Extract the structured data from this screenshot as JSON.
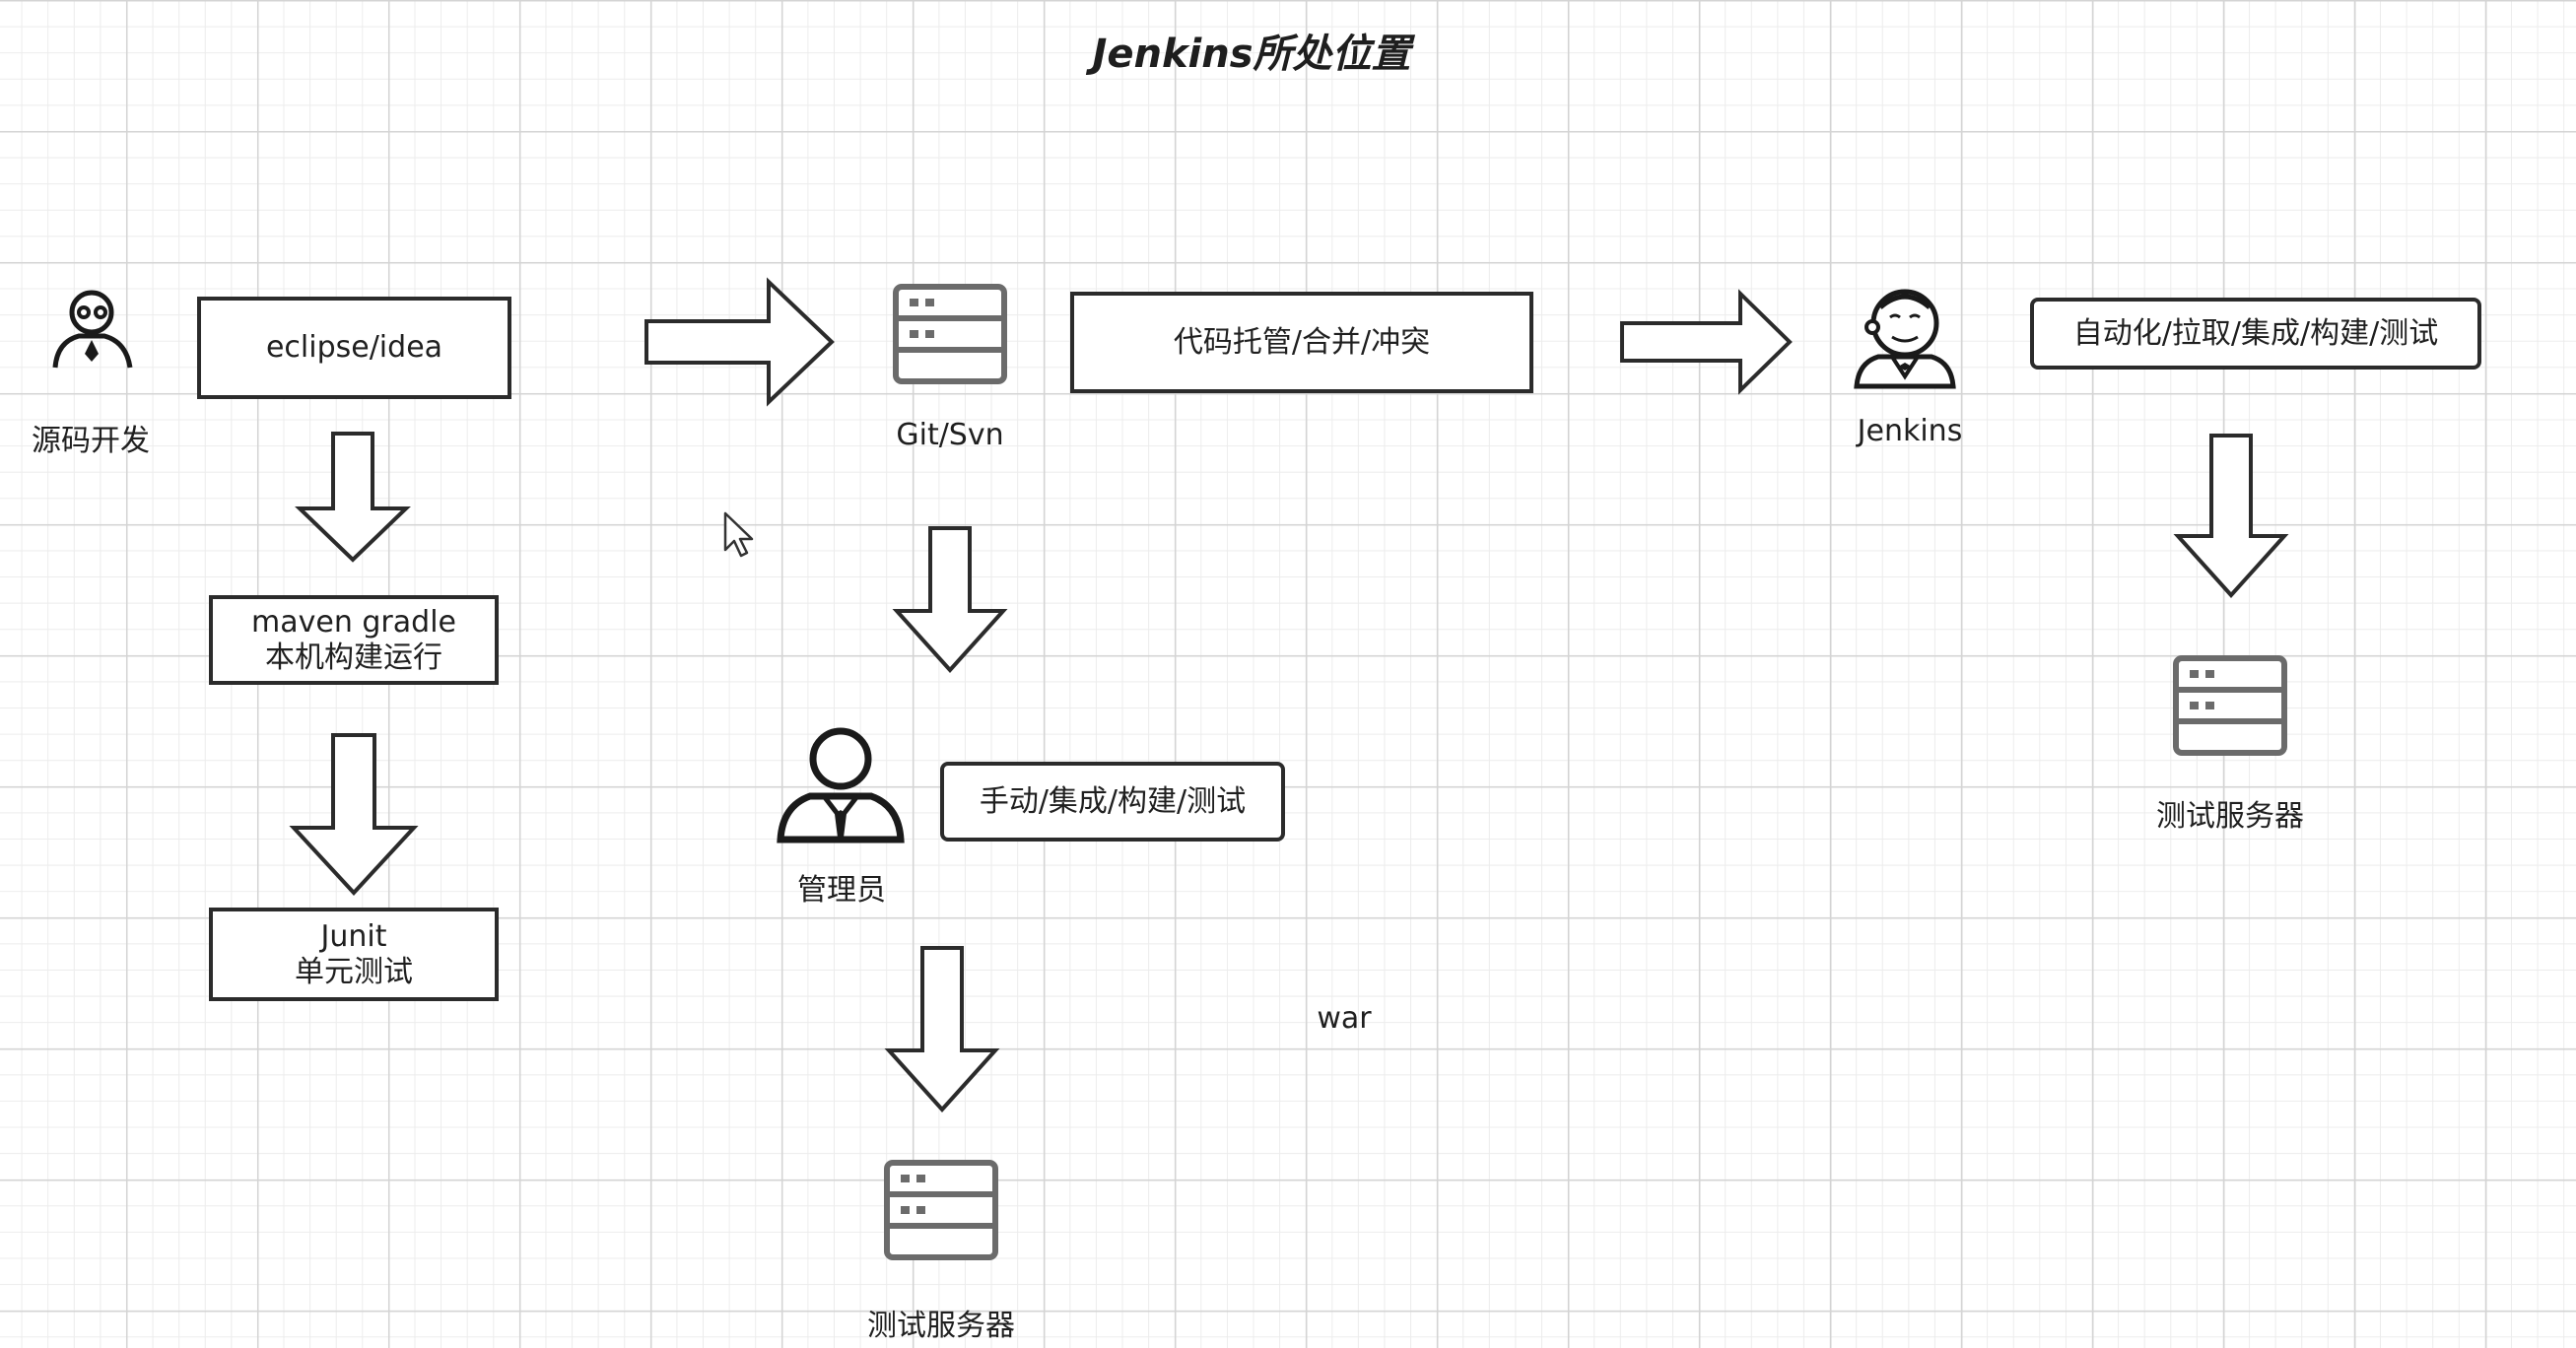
{
  "title": "Jenkins所处位置",
  "nodes": {
    "developer": {
      "label": "源码开发",
      "icon": "developer-icon"
    },
    "ide": {
      "label": "eclipse/idea"
    },
    "maven": {
      "line1": "maven gradle",
      "line2": "本机构建运行"
    },
    "junit": {
      "line1": "Junit",
      "line2": "单元测试"
    },
    "git": {
      "label": "Git/Svn",
      "icon": "server-icon"
    },
    "repo": {
      "label": "代码托管/合并/冲突"
    },
    "jenkins": {
      "label": "Jenkins",
      "icon": "jenkins-butler-icon"
    },
    "auto": {
      "label": "自动化/拉取/集成/构建/测试"
    },
    "test_server_right": {
      "label": "测试服务器",
      "icon": "server-icon"
    },
    "admin": {
      "label": "管理员",
      "icon": "admin-user-icon"
    },
    "manual": {
      "label": "手动/集成/构建/测试"
    },
    "test_server_bottom": {
      "label": "测试服务器",
      "icon": "server-icon"
    },
    "war": {
      "label": "war"
    }
  },
  "colors": {
    "stroke": "#2b2b2b",
    "server_stroke": "#6b6b6b",
    "grid_major": "#d4d4d4",
    "grid_minor": "#ececec"
  }
}
